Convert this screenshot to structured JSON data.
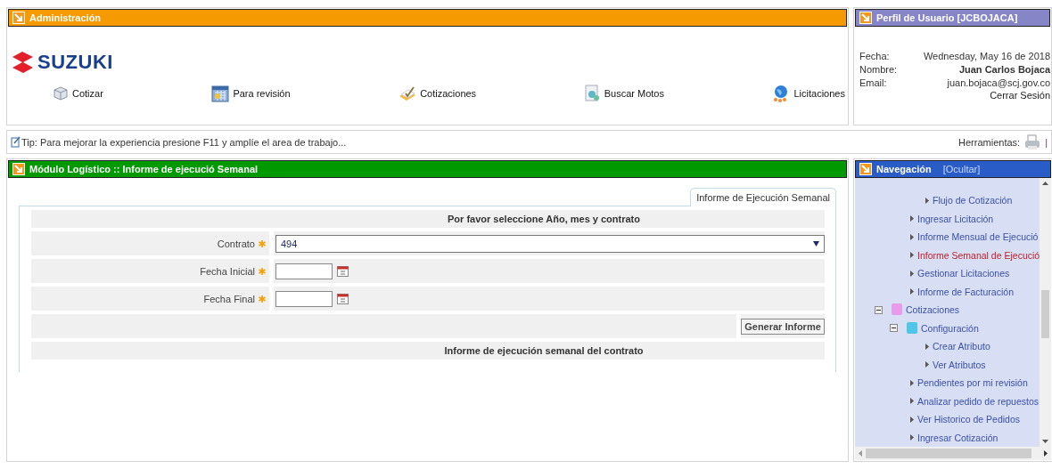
{
  "admin": {
    "title": "Administración",
    "logo": "SUZUKI",
    "shortcuts": [
      {
        "label": "Cotizar",
        "kind": "box"
      },
      {
        "label": "Para revisión",
        "kind": "calendar"
      },
      {
        "label": "Cotizaciones",
        "kind": "check"
      },
      {
        "label": "Buscar Motos",
        "kind": "search"
      },
      {
        "label": "Licitaciones",
        "kind": "globe"
      }
    ]
  },
  "profile": {
    "title": "Perfil de Usuario [JCBOJACA]",
    "fields": [
      {
        "label": "Fecha:",
        "value": "Wednesday, May 16 de 2018",
        "bold": false
      },
      {
        "label": "Nombre:",
        "value": "Juan Carlos Bojaca",
        "bold": true
      },
      {
        "label": "Email:",
        "value": "juan.bojaca@scj.gov.co",
        "bold": false
      }
    ],
    "logout": "Cerrar Sesión"
  },
  "tip_bar": {
    "tip": "Tip: Para mejorar la experiencia presione F11 y amplíe el area de trabajo...",
    "tools_label": "Herramientas:",
    "separator": "|"
  },
  "module": {
    "title": "Módulo Logístico :: Informe de ejecució Semanal",
    "tabs": [
      {
        "label": "Informe de Ejecución Semanal",
        "selected": true
      }
    ],
    "form_title": "Por favor seleccione Año, mes y contrato",
    "fields": [
      {
        "label": "Contrato",
        "kind": "select",
        "value": "494",
        "required": true
      },
      {
        "label": "Fecha Inicial",
        "kind": "date",
        "required": true
      },
      {
        "label": "Fecha Final",
        "kind": "date",
        "required": true
      }
    ],
    "button": "Generar Informe",
    "result_title": "Informe de ejecución semanal del contrato"
  },
  "navigation": {
    "title": "Navegación",
    "toggle": "[Ocultar]",
    "tree": [
      {
        "kind": "module",
        "children": [
          {
            "kind": "folder",
            "children": [
              {
                "kind": "link",
                "label": "Flujo de Cotización",
                "selected": false
              }
            ]
          },
          {
            "kind": "link",
            "label": "Ingresar Licitación",
            "selected": false
          },
          {
            "kind": "link",
            "label": "Informe Mensual de Ejecució",
            "selected": false
          },
          {
            "kind": "link",
            "label": "Informe Semanal de Ejecució",
            "selected": true
          },
          {
            "kind": "link",
            "label": "Gestionar Licitaciones",
            "selected": false
          },
          {
            "kind": "link",
            "label": "Informe de Facturación",
            "selected": false
          }
        ]
      },
      {
        "kind": "module",
        "label": "Cotizaciones",
        "expanded": true,
        "color": "#e89be8",
        "children": [
          {
            "kind": "folder",
            "label": "Configuración",
            "expanded": true,
            "color": "#4fc6e8",
            "children": [
              {
                "kind": "link",
                "label": "Crear Atributo",
                "selected": false
              },
              {
                "kind": "link",
                "label": "Ver Atributos",
                "selected": false
              }
            ]
          },
          {
            "kind": "link",
            "label": "Pendientes por mi revisión",
            "selected": false
          },
          {
            "kind": "link",
            "label": "Analizar pedido de repuestos",
            "selected": false
          },
          {
            "kind": "link",
            "label": "Ver Historico de Pedidos",
            "selected": false
          },
          {
            "kind": "link",
            "label": "Ingresar Cotización",
            "selected": false
          }
        ]
      }
    ]
  }
}
